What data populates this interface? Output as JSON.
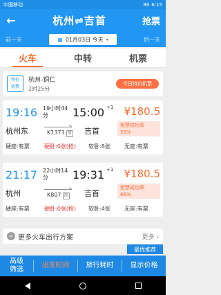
{
  "status_bar": {
    "carrier": "中国移动",
    "battery": "88",
    "time": "6:15"
  },
  "header": {
    "route": "杭州⇌吉首",
    "back_icon": "left-arrow-icon",
    "action_label": "抢票"
  },
  "date_bar": {
    "prev": "前一天",
    "date": "01月03日 今天",
    "next": "后一天"
  },
  "tabs": [
    {
      "label": "火车",
      "active": true
    },
    {
      "label": "中转",
      "active": false
    },
    {
      "label": "机票",
      "active": false
    }
  ],
  "special": {
    "badge_line1": "特价",
    "badge_line2": "机票",
    "route": "杭州-铜仁",
    "duration": "2时25分",
    "tag": "今日特价机票"
  },
  "trains": [
    {
      "dep_time": "19:16",
      "duration": "19小时44分",
      "arr_time": "15:00",
      "plus_day": "+1",
      "price": "¥180.5",
      "dep_station": "杭州东",
      "train_no": "K1373",
      "jian": "简",
      "arr_station": "吉首",
      "rate_label": "抢票成功率",
      "rate": "55%",
      "seats": [
        {
          "label": "硬座:有票",
          "red": false
        },
        {
          "label": "硬卧:0张(抢)",
          "red": true
        },
        {
          "label": "软卧:8张",
          "red": false
        },
        {
          "label": "无座:有票",
          "red": false
        }
      ]
    },
    {
      "dep_time": "21:17",
      "duration": "22小时14分",
      "arr_time": "19:31",
      "plus_day": "+1",
      "price": "¥180.5",
      "dep_station": "杭州",
      "train_no": "K807",
      "jian": "简",
      "arr_station": "吉首",
      "rate_label": "抢票成功率",
      "rate": "66%",
      "seats": [
        {
          "label": "硬座:有票",
          "red": false
        },
        {
          "label": "硬卧:0张(抢)",
          "red": true
        },
        {
          "label": "软卧:4张",
          "red": false
        },
        {
          "label": "无座:有票",
          "red": false
        }
      ]
    }
  ],
  "more": {
    "label": "更多火车出行方案",
    "more_btn": "更多 ›"
  },
  "recommend": "最优推荐",
  "filter_bar": {
    "filter": "高级筛选",
    "depart": "出发时间",
    "travel": "旅行耗时",
    "price": "显示价格"
  },
  "colors": {
    "primary": "#2196f3",
    "accent": "#ff6b2c"
  }
}
